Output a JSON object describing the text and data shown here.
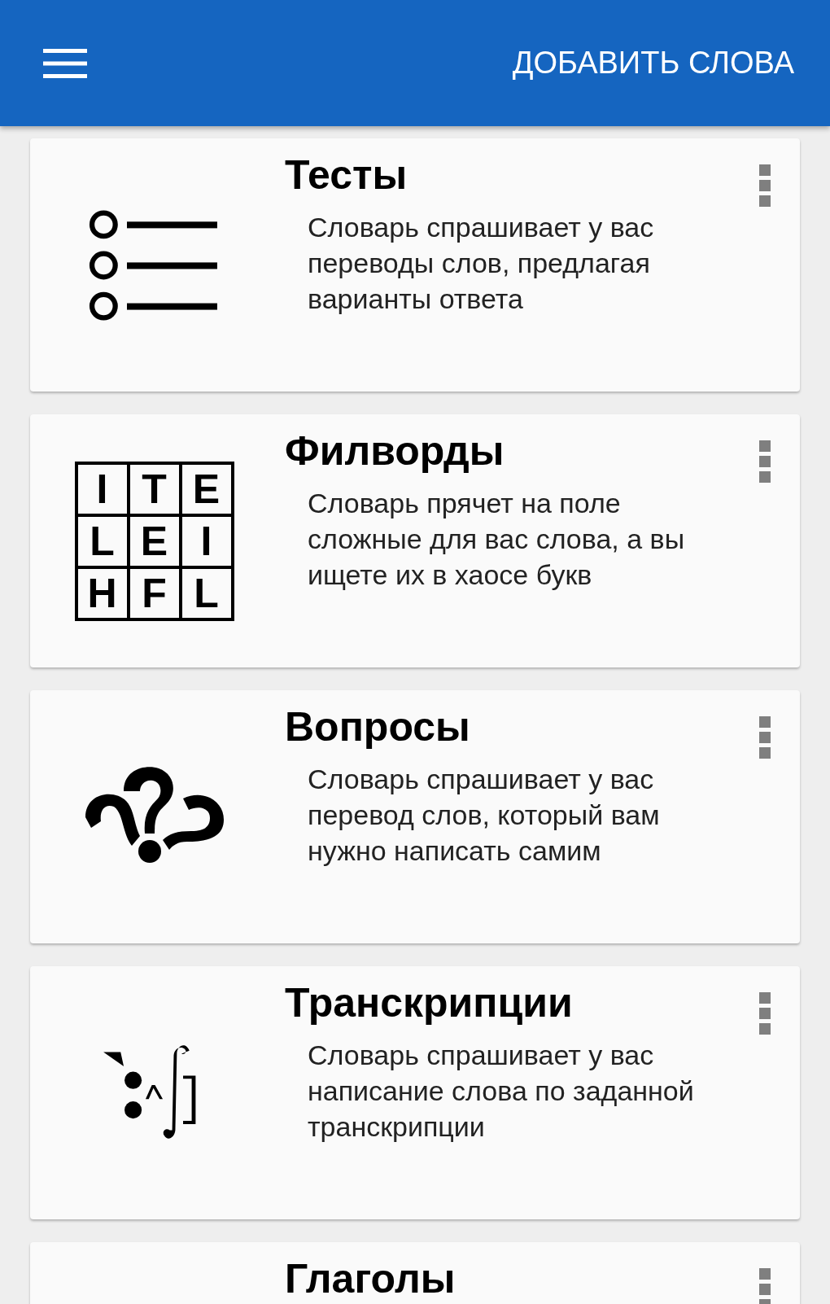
{
  "app_bar": {
    "action": "ДОБАВИТЬ СЛОВА"
  },
  "cards": [
    {
      "kind": "list",
      "title": "Тесты",
      "description": "Словарь спрашивает у вас переводы слов, предлагая варианты ответа"
    },
    {
      "kind": "grid",
      "title": "Филворды",
      "description": "Словарь прячет на поле сложные для вас слова, а вы ищете их в хаосе букв",
      "grid_letters": [
        "I",
        "T",
        "E",
        "L",
        "E",
        "I",
        "H",
        "F",
        "L"
      ]
    },
    {
      "kind": "questions",
      "title": "Вопросы",
      "description": "Словарь спрашивает у вас перевод слов, который вам нужно написать самим"
    },
    {
      "kind": "transcription",
      "title": "Транскрипции",
      "description": "Словарь спрашивает у вас написание слова по заданной транскрипции"
    },
    {
      "kind": "none",
      "title": "Глаголы"
    }
  ]
}
